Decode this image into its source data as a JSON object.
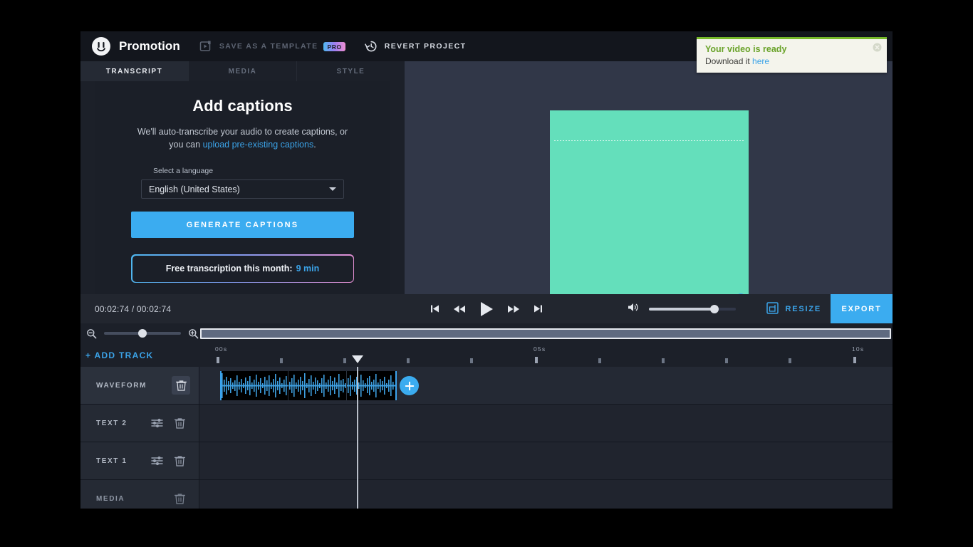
{
  "topbar": {
    "logo_icon": "headliner-logo-icon",
    "title": "Promotion",
    "save_template_label": "SAVE AS A TEMPLATE",
    "save_template_icon": "template-icon",
    "pro_badge": "PRO",
    "revert_label": "REVERT PROJECT",
    "revert_icon": "history-clock-icon"
  },
  "toast": {
    "title": "Your video is ready",
    "body_prefix": "Download it ",
    "link": "here",
    "close_icon": "close-circle-icon",
    "accent_color": "#76b82a",
    "link_color": "#3aa3e8"
  },
  "left_panel": {
    "tabs": [
      {
        "label": "TRANSCRIPT",
        "active": true
      },
      {
        "label": "MEDIA",
        "active": false
      },
      {
        "label": "STYLE",
        "active": false
      }
    ],
    "heading": "Add captions",
    "description_prefix": "We'll auto-transcribe your audio to create captions, or you can ",
    "description_link": "upload pre-existing captions",
    "description_suffix": ".",
    "language_label": "Select a language",
    "language_value": "English (United States)",
    "generate_button": "GENERATE CAPTIONS",
    "free_transcription_label": "Free transcription this month:",
    "free_transcription_value": "9 min"
  },
  "preview": {
    "canvas_color": "#64dfbb",
    "progress_color": "#3ba3ee",
    "progress_percent": 100
  },
  "transport": {
    "current_time": "00:02:74",
    "total_time": "00:02:74",
    "timecode": "00:02:74 / 00:02:74",
    "controls": [
      "skip-to-start-icon",
      "rewind-icon",
      "play-icon",
      "fast-forward-icon",
      "skip-to-end-icon"
    ],
    "volume_icon": "volume-icon",
    "volume_percent": 75,
    "resize_label": "RESIZE",
    "resize_icon": "resize-icon",
    "export_label": "EXPORT",
    "accent_color": "#3bacf0"
  },
  "zoom_row": {
    "zoom_out_icon": "zoom-out-icon",
    "zoom_in_icon": "zoom-in-icon",
    "zoom_percent": 50
  },
  "timeline": {
    "add_track_label": "+ ADD TRACK",
    "ruler_labels": [
      "00s",
      "05s",
      "10s"
    ],
    "playhead_time": "00:02:74",
    "add_clip_icon": "plus-icon",
    "tracks": [
      {
        "name": "WAVEFORM",
        "has_settings": false,
        "has_delete": true,
        "highlighted": true
      },
      {
        "name": "TEXT 2",
        "has_settings": true,
        "has_delete": true,
        "highlighted": false
      },
      {
        "name": "TEXT 1",
        "has_settings": true,
        "has_delete": true,
        "highlighted": false
      },
      {
        "name": "MEDIA",
        "has_settings": false,
        "has_delete": true,
        "highlighted": false
      }
    ],
    "settings_icon": "sliders-icon",
    "delete_icon": "trash-icon"
  }
}
